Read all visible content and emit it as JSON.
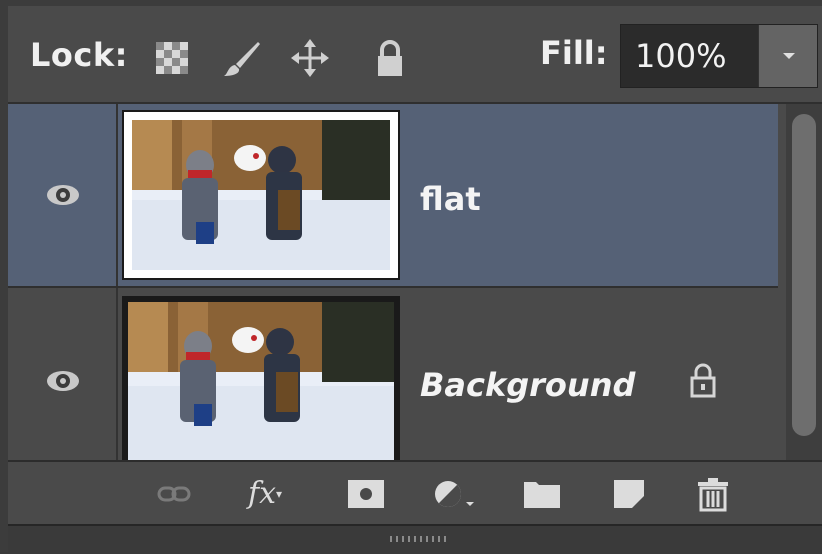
{
  "lock_bar": {
    "lock_label": "Lock:",
    "lock_icons": [
      "transparency-lock-icon",
      "brush-lock-icon",
      "move-lock-icon",
      "padlock-icon"
    ],
    "fill_label": "Fill:",
    "fill_value": "100%"
  },
  "layers": [
    {
      "name": "flat",
      "selected": true,
      "visible": true,
      "locked": false
    },
    {
      "name": "Background",
      "selected": false,
      "visible": true,
      "locked": true
    }
  ],
  "toolbar": {
    "icons": [
      "link-layers-icon",
      "fx-icon",
      "add-mask-icon",
      "adjustment-layer-icon",
      "new-group-folder-icon",
      "new-layer-icon",
      "trash-icon"
    ],
    "fx_label": "fx"
  },
  "colors": {
    "panel": "#4a4a4a",
    "selected_row": "#556176",
    "text": "#f4f4f4"
  }
}
